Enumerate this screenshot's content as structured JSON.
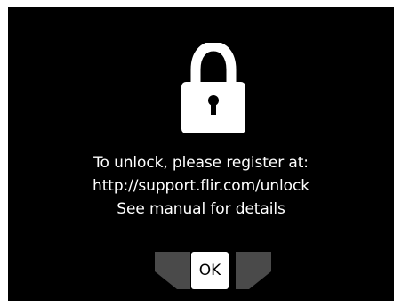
{
  "dialog": {
    "icon": "lock-icon",
    "message_lines": [
      "To unlock, please register at:",
      "http://support.flir.com/unlock",
      "See manual for details"
    ]
  },
  "controls": {
    "left_icon": "chevron-left-icon",
    "ok_label": "OK",
    "right_icon": "chevron-right-icon"
  },
  "colors": {
    "background": "#000000",
    "foreground": "#ffffff",
    "inactive_arrow": "#4a4a4a"
  }
}
